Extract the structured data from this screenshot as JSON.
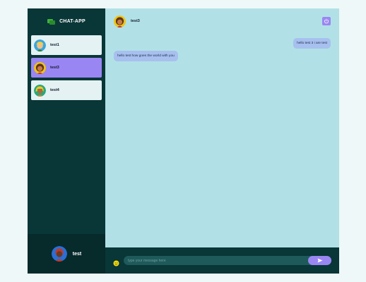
{
  "brand": {
    "title": "CHAT-APP",
    "icon": "chat-bubbles-icon"
  },
  "contacts": [
    {
      "name": "test1",
      "selected": false,
      "avatar": "blond-avatar-icon"
    },
    {
      "name": "test3",
      "selected": true,
      "avatar": "curly-avatar-icon"
    },
    {
      "name": "test4",
      "selected": false,
      "avatar": "yellow-hair-avatar-icon"
    }
  ],
  "current_user": {
    "name": "test",
    "avatar": "red-hair-avatar-icon"
  },
  "chat": {
    "header_name": "test3",
    "logout_icon": "power-icon",
    "messages": [
      {
        "text": "hello test 3 i are test",
        "direction": "sent"
      },
      {
        "text": "hello test how goes the world with you",
        "direction": "received"
      }
    ]
  },
  "composer": {
    "placeholder": "type your message here",
    "emoji_icon": "smiley-icon",
    "send_icon": "send-icon"
  },
  "colors": {
    "sidebar_bg": "#093637",
    "chat_bg": "#b1e1e6",
    "accent": "#9a86f3",
    "bubble": "#a7c0ef"
  }
}
